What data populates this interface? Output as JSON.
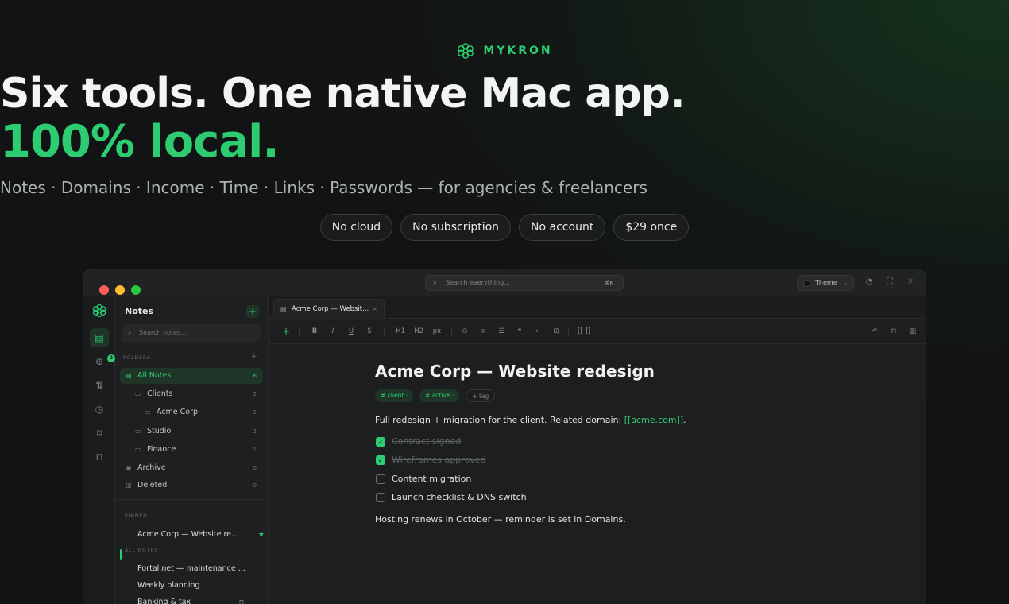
{
  "hero": {
    "brand": "MYKRON",
    "headline": "Six tools. One native Mac app.",
    "headline_accent": "100% local.",
    "tagline": "Notes · Domains · Income · Time · Links · Passwords — for agencies & freelancers",
    "pills": [
      "No cloud",
      "No subscription",
      "No account",
      "$29 once"
    ]
  },
  "window": {
    "search_placeholder": "Search everything...",
    "search_shortcut": "⌘K",
    "theme_label": "Theme",
    "rail_badge": "2",
    "sidebar": {
      "title": "Notes",
      "search_placeholder": "Search notes...",
      "folders_label": "FOLDERS",
      "folders": [
        {
          "label": "All Notes",
          "count": "6"
        },
        {
          "label": "Clients",
          "count": "2"
        },
        {
          "label": "Acme Corp",
          "count": "1"
        },
        {
          "label": "Studio",
          "count": "2"
        },
        {
          "label": "Finance",
          "count": "1"
        },
        {
          "label": "Archive",
          "count": "0"
        },
        {
          "label": "Deleted",
          "count": "0"
        }
      ],
      "pinned_label": "PINNED",
      "pinned_note": "Acme Corp — Website re...",
      "all_notes_label": "ALL NOTES",
      "notes": [
        "Portal.net — maintenance ...",
        "Weekly planning",
        "Banking & tax"
      ]
    },
    "tab_title": "Acme Corp — Websit...",
    "toolbar": {
      "h1": "H1",
      "h2": "H2",
      "px": "px",
      "wiki": "[[ ]]"
    },
    "document": {
      "title": "Acme Corp — Website redesign",
      "tags": [
        "# client ·",
        "# active ·",
        "+ tag"
      ],
      "intro": "Full redesign + migration for the client. Related domain: ",
      "intro_link": "[[acme.com]]",
      "intro_end": ".",
      "tasks": [
        {
          "label": "Contract signed",
          "done": true
        },
        {
          "label": "Wireframes approved",
          "done": true
        },
        {
          "label": "Content migration",
          "done": false
        },
        {
          "label": "Launch checklist & DNS switch",
          "done": false
        }
      ],
      "footer": "Hosting renews in October — reminder is set in Domains."
    }
  },
  "colors": {
    "accent": "#2ecc71",
    "background": "#121314",
    "window": "#1d1e1f"
  }
}
